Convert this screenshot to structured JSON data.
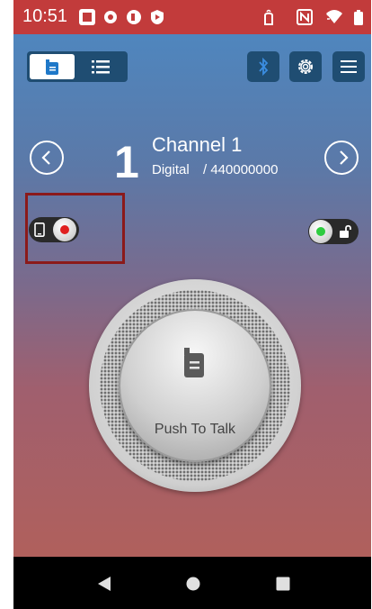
{
  "status_bar": {
    "time": "10:51",
    "icons": [
      "notification-app-icon",
      "gear-icon",
      "vpn-shield-icon",
      "play-protect-icon",
      "nfc-tag-icon",
      "nfc-icon",
      "wifi-icon",
      "battery-icon"
    ]
  },
  "toolbar": {
    "view_toggle_icons": [
      "radio-device-icon",
      "list-icon"
    ],
    "action_icons": [
      "bluetooth-icon",
      "gear-icon",
      "menu-icon"
    ]
  },
  "channel": {
    "number": "1",
    "name": "Channel 1",
    "mode": "Digital",
    "frequency": "/ 440000000"
  },
  "switches": {
    "left": {
      "icon": "phone-icon",
      "indicator_color": "#e02020"
    },
    "right": {
      "icon": "unlock-icon",
      "indicator_color": "#2ecc40"
    }
  },
  "ptt": {
    "label": "Push To Talk",
    "icon": "radio-device-icon"
  },
  "nav": {
    "icons": [
      "back-icon",
      "home-icon",
      "recents-icon"
    ]
  },
  "colors": {
    "status_bar": "#c23b3b",
    "button_bg": "#1f4d72",
    "highlight_box": "#8b1a1a"
  }
}
